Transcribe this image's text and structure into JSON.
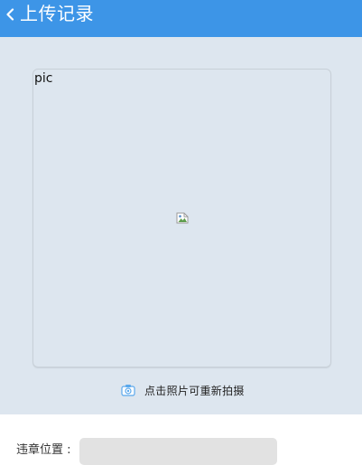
{
  "header": {
    "back_icon": "chevron-left-icon",
    "title": "上传记录",
    "color": "#3d95e7"
  },
  "photo": {
    "alt_text": "pic",
    "placeholder_icon": "broken-image-icon",
    "background": "#dde6ef"
  },
  "retake": {
    "icon": "camera-icon",
    "text": "点击照片可重新拍摄"
  },
  "form": {
    "location_label": "违章位置 :",
    "location_value": ""
  }
}
